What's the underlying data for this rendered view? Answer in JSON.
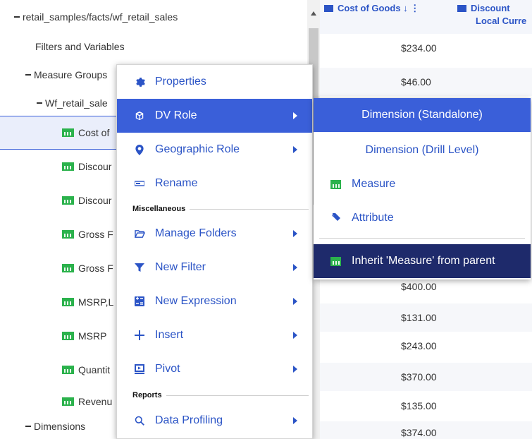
{
  "tree": {
    "rows": [
      {
        "label": "retail_samples/facts/wf_retail_sales",
        "indent": 0,
        "toggle": "dash",
        "icon": null
      },
      {
        "label": "Filters and Variables",
        "indent": 1,
        "toggle": null,
        "icon": null
      },
      {
        "label": "Measure Groups",
        "indent": 1,
        "toggle": "dash",
        "icon": null
      },
      {
        "label": "Wf_retail_sale",
        "indent": 2,
        "toggle": "dash",
        "icon": null
      },
      {
        "label": "Cost of",
        "indent": 3,
        "toggle": null,
        "icon": "measure-icon",
        "selected": true
      },
      {
        "label": "Discour",
        "indent": 3,
        "toggle": null,
        "icon": "measure-icon"
      },
      {
        "label": "Discour",
        "indent": 3,
        "toggle": null,
        "icon": "measure-icon"
      },
      {
        "label": "Gross F",
        "indent": 3,
        "toggle": null,
        "icon": "measure-icon"
      },
      {
        "label": "Gross F",
        "indent": 3,
        "toggle": null,
        "icon": "measure-icon"
      },
      {
        "label": "MSRP,L",
        "indent": 3,
        "toggle": null,
        "icon": "measure-icon"
      },
      {
        "label": "MSRP",
        "indent": 3,
        "toggle": null,
        "icon": "measure-icon"
      },
      {
        "label": "Quantit",
        "indent": 3,
        "toggle": null,
        "icon": "measure-icon"
      },
      {
        "label": "Revenu",
        "indent": 3,
        "toggle": null,
        "icon": "measure-icon"
      },
      {
        "label": "Revenu",
        "indent": 3,
        "toggle": null,
        "icon": "measure-icon"
      },
      {
        "label": "Dimensions",
        "indent": 0,
        "toggle": "dash",
        "icon": null
      }
    ]
  },
  "grid": {
    "columns": [
      {
        "line1": "Cost of Goods ↓ ⋮",
        "line2": ""
      },
      {
        "line1": "Discount",
        "line2": "Local Curre"
      }
    ],
    "cells": [
      "$234.00",
      "$46.00",
      "",
      "",
      "",
      "",
      "",
      "$400.00",
      "$131.00",
      "$243.00",
      "$370.00",
      "$135.00",
      "$374.00"
    ]
  },
  "menu": {
    "items": [
      {
        "label": "Properties",
        "icon": "gear-icon",
        "arrow": false
      },
      {
        "label": "DV Role",
        "icon": "cube-icon",
        "arrow": true,
        "active": true
      },
      {
        "label": "Geographic Role",
        "icon": "map-pin-icon",
        "arrow": true
      },
      {
        "label": "Rename",
        "icon": "rename-icon",
        "arrow": false
      },
      {
        "label": "Manage Folders",
        "icon": "folder-icon",
        "arrow": true
      },
      {
        "label": "New Filter",
        "icon": "filter-icon",
        "arrow": true
      },
      {
        "label": "New Expression",
        "icon": "expression-icon",
        "arrow": true
      },
      {
        "label": "Insert",
        "icon": "plus-icon",
        "arrow": true
      },
      {
        "label": "Pivot",
        "icon": "pivot-icon",
        "arrow": true
      },
      {
        "label": "Data Profiling",
        "icon": "search-icon",
        "arrow": true
      }
    ],
    "sections": {
      "misc": "Miscellaneous",
      "reports": "Reports"
    }
  },
  "submenu": {
    "items": [
      {
        "label": "Dimension (Standalone)",
        "state": "active"
      },
      {
        "label": "Dimension (Drill Level)",
        "state": "normal"
      },
      {
        "label": "Measure",
        "icon": "measure-icon",
        "state": "normal"
      },
      {
        "label": "Attribute",
        "icon": "attribute-icon",
        "state": "normal"
      },
      {
        "label": "Inherit 'Measure' from parent",
        "icon": "measure-icon",
        "state": "dark"
      }
    ]
  },
  "colors": {
    "accent": "#2b54c6",
    "active_bg": "#3a5fd9",
    "dark_bg": "#1e2a6b",
    "measure_green": "#2bb24c"
  }
}
